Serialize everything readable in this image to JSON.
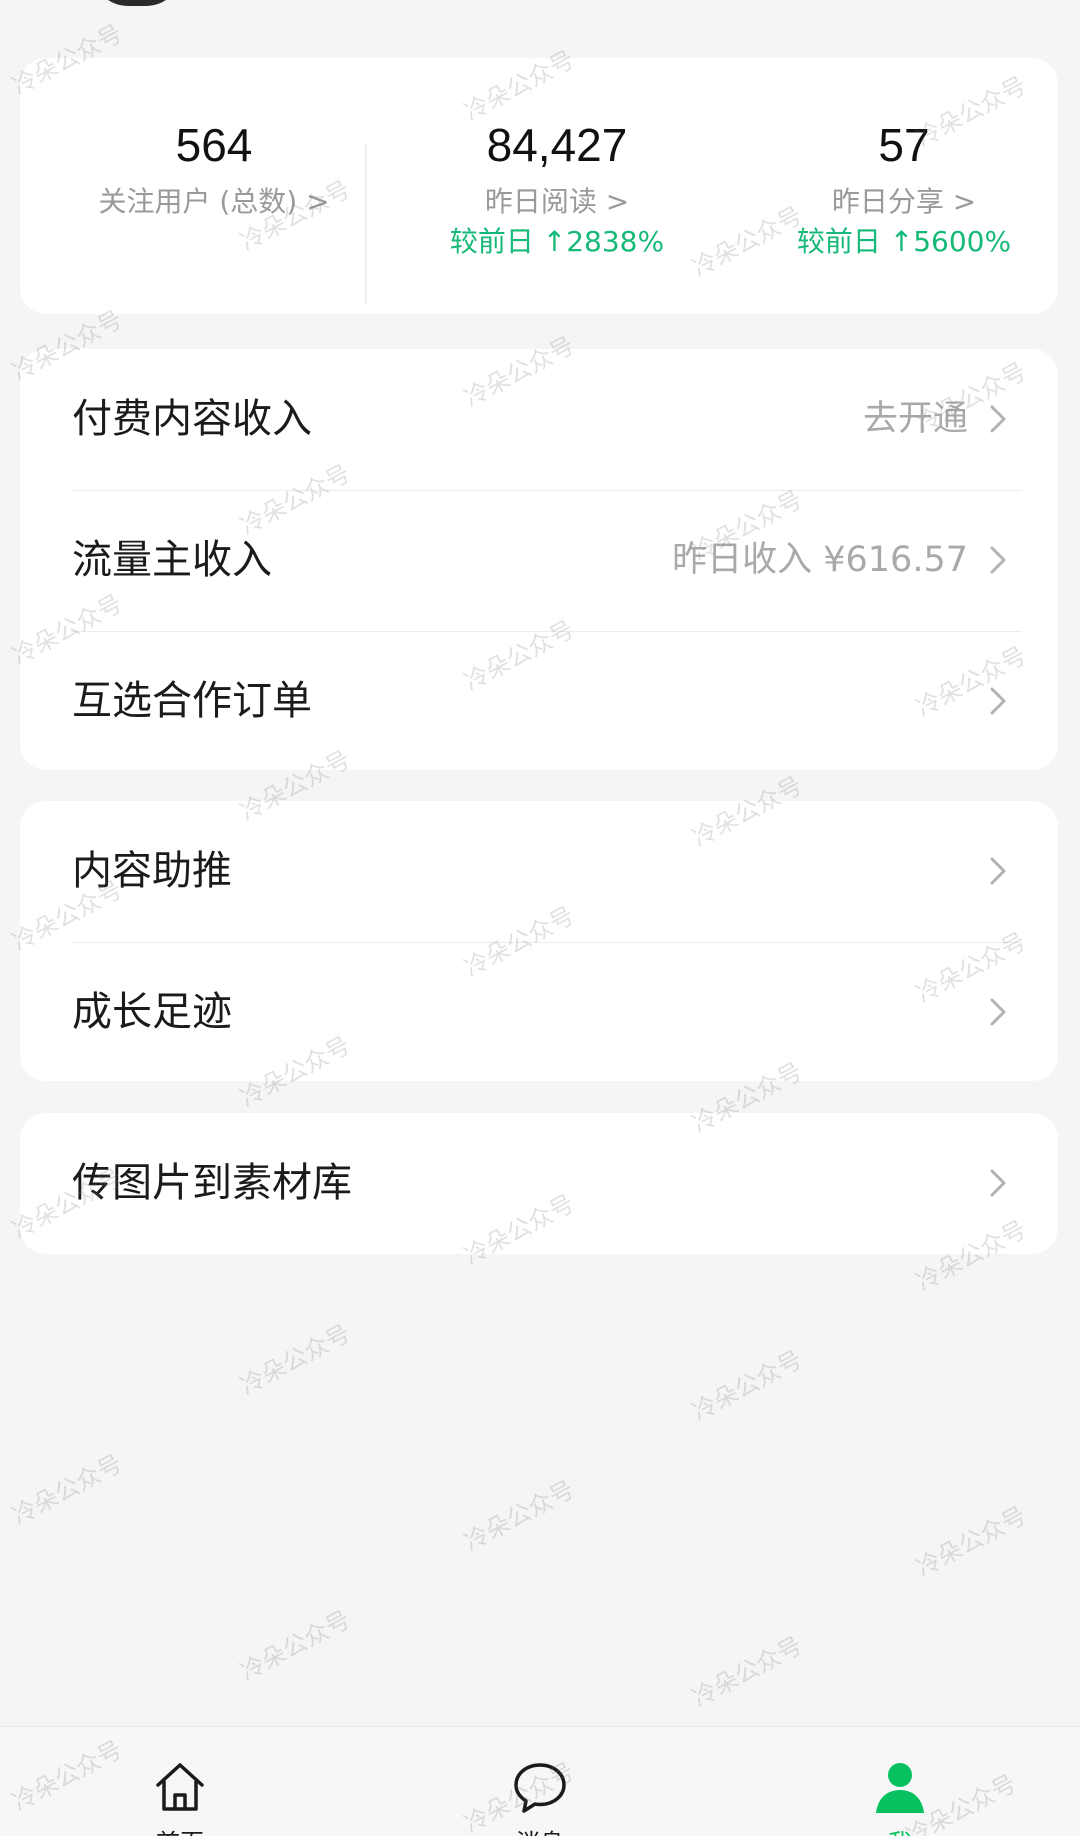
{
  "stats": [
    {
      "value": "564",
      "label": "关注用户 (总数) >",
      "change": ""
    },
    {
      "value": "84,427",
      "label": "昨日阅读 >",
      "change": "较前日 ↑2838%"
    },
    {
      "value": "57",
      "label": "昨日分享 >",
      "change": "较前日 ↑5600%"
    }
  ],
  "menu_pay": [
    {
      "label": "付费内容收入",
      "value": "去开通"
    },
    {
      "label": "流量主收入",
      "value": "昨日收入 ¥616.57"
    },
    {
      "label": "互选合作订单",
      "value": ""
    }
  ],
  "menu_grow": [
    {
      "label": "内容助推",
      "value": ""
    },
    {
      "label": "成长足迹",
      "value": ""
    }
  ],
  "menu_upload": [
    {
      "label": "传图片到素材库",
      "value": ""
    }
  ],
  "tabbar": {
    "home_label": "首页",
    "messages_label": "消息",
    "me_label": "我"
  },
  "watermark": "冷朵公众号",
  "colors": {
    "accent": "#07c160",
    "change": "#16b978"
  }
}
